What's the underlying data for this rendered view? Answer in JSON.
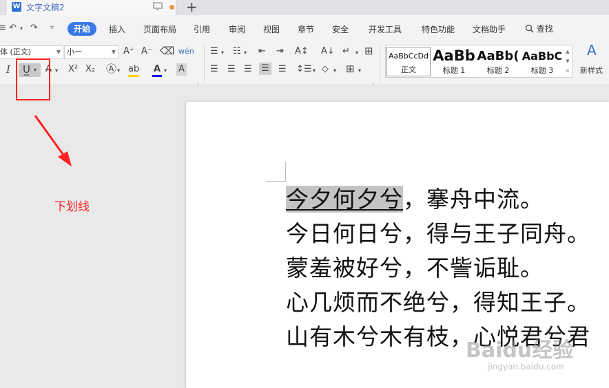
{
  "titlebar": {
    "logo_letter": "W",
    "doc_title": "文字文稿2",
    "new_tab": "+"
  },
  "menu": {
    "items": [
      "开始",
      "插入",
      "页面布局",
      "引用",
      "审阅",
      "视图",
      "章节",
      "安全",
      "开发工具",
      "特色功能",
      "文档助手"
    ],
    "active": "开始",
    "search_label": "查找"
  },
  "ribbon": {
    "font_name": "体 (正文)",
    "font_size": "小一",
    "grow_font": "A⁺",
    "shrink_font": "A⁻",
    "styles": [
      {
        "sample": "AaBbCcDd",
        "name": "正文"
      },
      {
        "sample": "AaBb",
        "name": "标题 1"
      },
      {
        "sample": "AaBb(",
        "name": "标题 2"
      },
      {
        "sample": "AaBbC",
        "name": "标题 3"
      }
    ],
    "new_style_label": "新样式",
    "font_color": "#0000ff",
    "highlight_color": "#ffd400"
  },
  "annotation": {
    "label": "下划线",
    "color": "#ff2020"
  },
  "document": {
    "lines": [
      {
        "selected": "今夕何夕兮",
        "rest": "，搴舟中流。"
      },
      {
        "selected": "",
        "rest": "今日何日兮，得与王子同舟。"
      },
      {
        "selected": "",
        "rest": "蒙羞被好兮，不訾诟耻。"
      },
      {
        "selected": "",
        "rest": "心几烦而不绝兮，得知王子。"
      },
      {
        "selected": "",
        "rest": "山有木兮木有枝，心悦君兮君"
      }
    ]
  },
  "watermark": {
    "brand": "Baidu经验",
    "url": "jingyan.baidu.com"
  }
}
